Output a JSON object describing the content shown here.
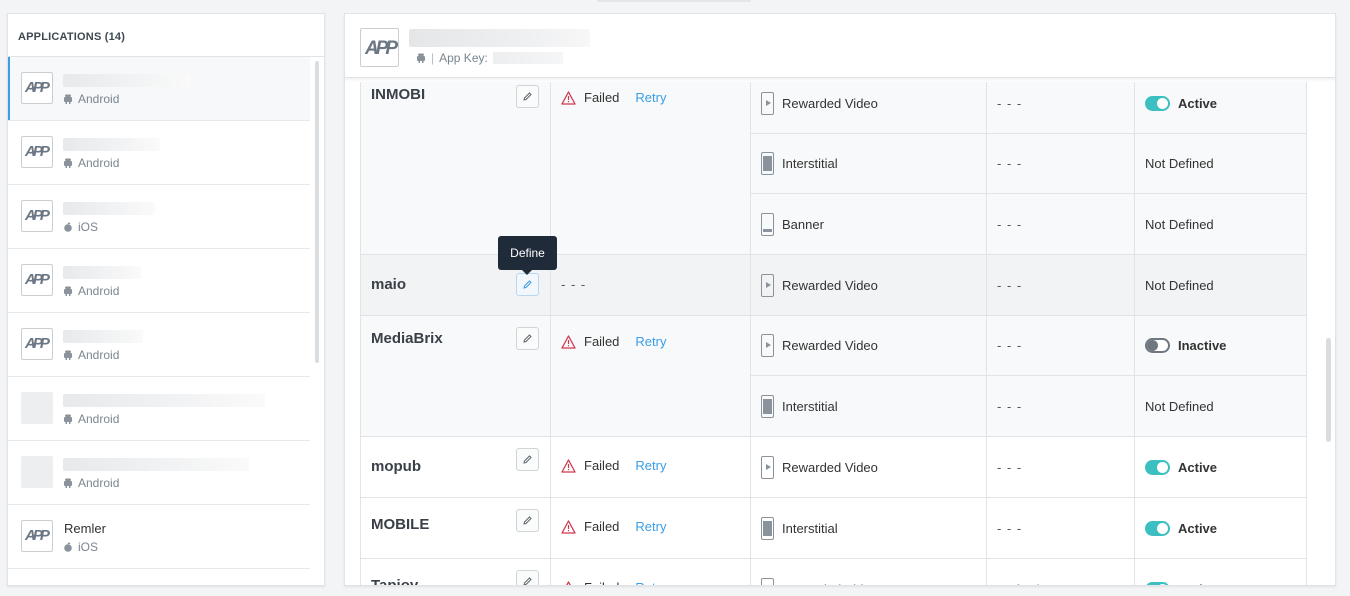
{
  "sidebar": {
    "header": "APPLICATIONS (14)",
    "apps": [
      {
        "logo": "APP",
        "name": "",
        "platform": "Android",
        "blur_w": 128
      },
      {
        "logo": "APP",
        "name": "",
        "platform": "Android",
        "blur_w": 97
      },
      {
        "logo": "APP",
        "name": "",
        "platform": "iOS",
        "blur_w": 92
      },
      {
        "logo": "APP",
        "name": "",
        "platform": "Android",
        "blur_w": 78
      },
      {
        "logo": "APP",
        "name": "",
        "platform": "Android",
        "blur_w": 80
      },
      {
        "logo": "",
        "name": "",
        "platform": "Android",
        "blur_w": 202
      },
      {
        "logo": "",
        "name": "",
        "platform": "Android",
        "blur_w": 186
      },
      {
        "logo": "APP",
        "name": "Remler",
        "platform": "iOS",
        "blur_w": 0
      }
    ]
  },
  "main": {
    "logo": "APP",
    "app_key_label": "App Key:",
    "separator": "|"
  },
  "networks": [
    {
      "name": "INMOBI",
      "status": "Failed",
      "retry": "Retry",
      "units": [
        {
          "type": "Rewarded Video",
          "icon": "video",
          "value": "- - -",
          "state": "Active",
          "toggle": "on"
        },
        {
          "type": "Interstitial",
          "icon": "interstitial",
          "value": "- - -",
          "state": "Not Defined",
          "toggle": ""
        },
        {
          "type": "Banner",
          "icon": "banner",
          "value": "- - -",
          "state": "Not Defined",
          "toggle": ""
        }
      ]
    },
    {
      "name": "maio",
      "status": "- - -",
      "retry": "",
      "units": [
        {
          "type": "Rewarded Video",
          "icon": "video",
          "value": "- - -",
          "state": "Not Defined",
          "toggle": ""
        }
      ]
    },
    {
      "name": "MediaBrix",
      "status": "Failed",
      "retry": "Retry",
      "units": [
        {
          "type": "Rewarded Video",
          "icon": "video",
          "value": "- - -",
          "state": "Inactive",
          "toggle": "off"
        },
        {
          "type": "Interstitial",
          "icon": "interstitial",
          "value": "- - -",
          "state": "Not Defined",
          "toggle": ""
        }
      ]
    },
    {
      "name": "mopub",
      "status": "Failed",
      "retry": "Retry",
      "units": [
        {
          "type": "Rewarded Video",
          "icon": "video",
          "value": "- - -",
          "state": "Active",
          "toggle": "on"
        }
      ]
    },
    {
      "name": "MOBILE",
      "status": "Failed",
      "retry": "Retry",
      "units": [
        {
          "type": "Interstitial",
          "icon": "interstitial",
          "value": "- - -",
          "state": "Active",
          "toggle": "on"
        }
      ]
    },
    {
      "name": "Tapjoy",
      "status": "Failed",
      "retry": "Retry",
      "units": [
        {
          "type": "Rewarded Video",
          "icon": "video",
          "value": "Default",
          "state": "Active",
          "toggle": "on"
        }
      ]
    }
  ],
  "tooltip": "Define",
  "colors": {
    "accent": "#3b9de6",
    "toggle_on": "#3bbfc1",
    "failed": "#d0384f"
  }
}
